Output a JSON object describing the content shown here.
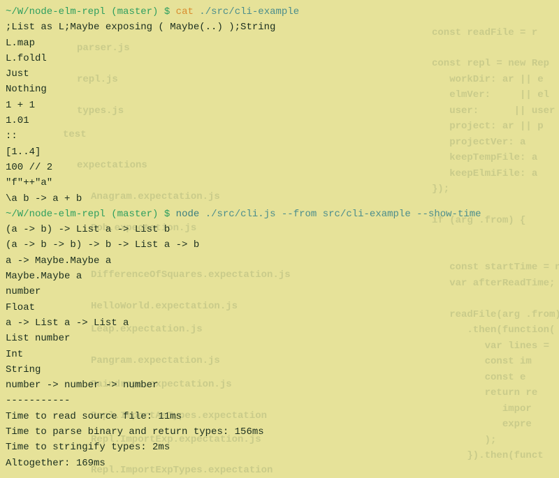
{
  "prompt1": {
    "path": "~/W/node-elm-repl",
    "branch": "(master)",
    "dollar": "$",
    "cmd": "cat",
    "arg": "./src/cli-example"
  },
  "cat_output": [
    ";List as L;Maybe exposing ( Maybe(..) );String",
    "L.map",
    "L.foldl",
    "Just",
    "Nothing",
    "1 + 1",
    "1.01",
    "::",
    "[1..4]",
    "100 // 2",
    "\"f\"++\"a\"",
    "\\a b -> a + b"
  ],
  "prompt2": {
    "path": "~/W/node-elm-repl",
    "branch": "(master)",
    "dollar": "$",
    "cmd": "node",
    "args": "./src/cli.js --from src/cli-example --show-time"
  },
  "node_output": [
    "(a -> b) -> List a -> List b",
    "(a -> b -> b) -> b -> List a -> b",
    "a -> Maybe.Maybe a",
    "Maybe.Maybe a",
    "number",
    "Float",
    "a -> List a -> List a",
    "List number",
    "Int",
    "String",
    "number -> number -> number",
    "-----------",
    "Time to read source file: 11ms",
    "Time to parse binary and return types: 156ms",
    "Time to stringify types: 2ms",
    "Altogether: 169ms"
  ],
  "ghost_left": [
    "parser.js",
    "repl.js",
    "types.js",
    "test",
    "expectations",
    "Anagram.expectation.js",
    "Bob.expectation.js",
    "DifferenceOfSquares.expectation.js",
    "HelloWorld.expectation.js",
    "Leap.expectation.js",
    "Pangram.expectation.js",
    "Raindrops.expectation.js",
    "Repl.ImportAsTypes.expectation",
    "Repl.ImportExp.expectation.js",
    "Repl.ImportExpTypes.expectation"
  ],
  "ghost_right": [
    "const readFile = r",
    "",
    "const repl = new Rep",
    "   workDir: ar || e",
    "   elmVer:     || el",
    "   user:      || user",
    "   project: ar || p",
    "   projectVer: a",
    "   keepTempFile: a",
    "   keepElmiFile: a",
    "});",
    "",
    "if (arg .from) {",
    "",
    "   const startTime = n",
    "   var afterReadTime;",
    "",
    "   readFile(arg .from)",
    "      .then(function(",
    "         var lines =",
    "         const im",
    "         const e",
    "         return re",
    "            impor",
    "            expre",
    "         );",
    "      }).then(funct"
  ]
}
